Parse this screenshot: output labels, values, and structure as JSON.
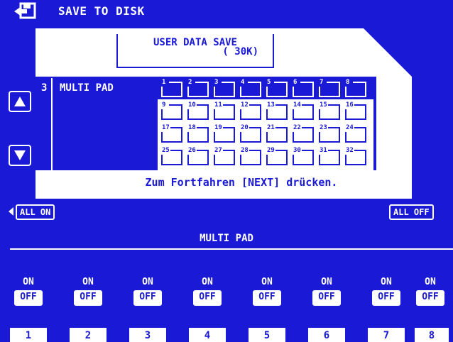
{
  "header": {
    "title": "SAVE TO DISK",
    "icon": "save-to-disk-icon"
  },
  "info_box": {
    "title": "USER DATA SAVE",
    "size": "(    30K)"
  },
  "list": {
    "row_number": "3",
    "row_name": "MULTI PAD",
    "pads": [
      "1",
      "2",
      "3",
      "4",
      "5",
      "6",
      "7",
      "8",
      "9",
      "10",
      "11",
      "12",
      "13",
      "14",
      "15",
      "16",
      "17",
      "18",
      "19",
      "20",
      "21",
      "22",
      "23",
      "24",
      "25",
      "26",
      "27",
      "28",
      "29",
      "30",
      "31",
      "32"
    ]
  },
  "message": "Zum Fortfahren [NEXT] drücken.",
  "all_on_label": "ALL ON",
  "all_off_label": "ALL OFF",
  "section_label": "MULTI PAD",
  "toggles": [
    {
      "on": "ON",
      "off": "OFF"
    },
    {
      "on": "ON",
      "off": "OFF"
    },
    {
      "on": "ON",
      "off": "OFF"
    },
    {
      "on": "ON",
      "off": "OFF"
    },
    {
      "on": "ON",
      "off": "OFF"
    },
    {
      "on": "ON",
      "off": "OFF"
    },
    {
      "on": "ON",
      "off": "OFF"
    },
    {
      "on": "ON",
      "off": "OFF"
    }
  ],
  "tabs": [
    "1",
    "2",
    "3",
    "4",
    "5",
    "6",
    "7",
    "8"
  ],
  "colors": {
    "background": "#1a1ad6",
    "foreground": "#ffffff"
  }
}
